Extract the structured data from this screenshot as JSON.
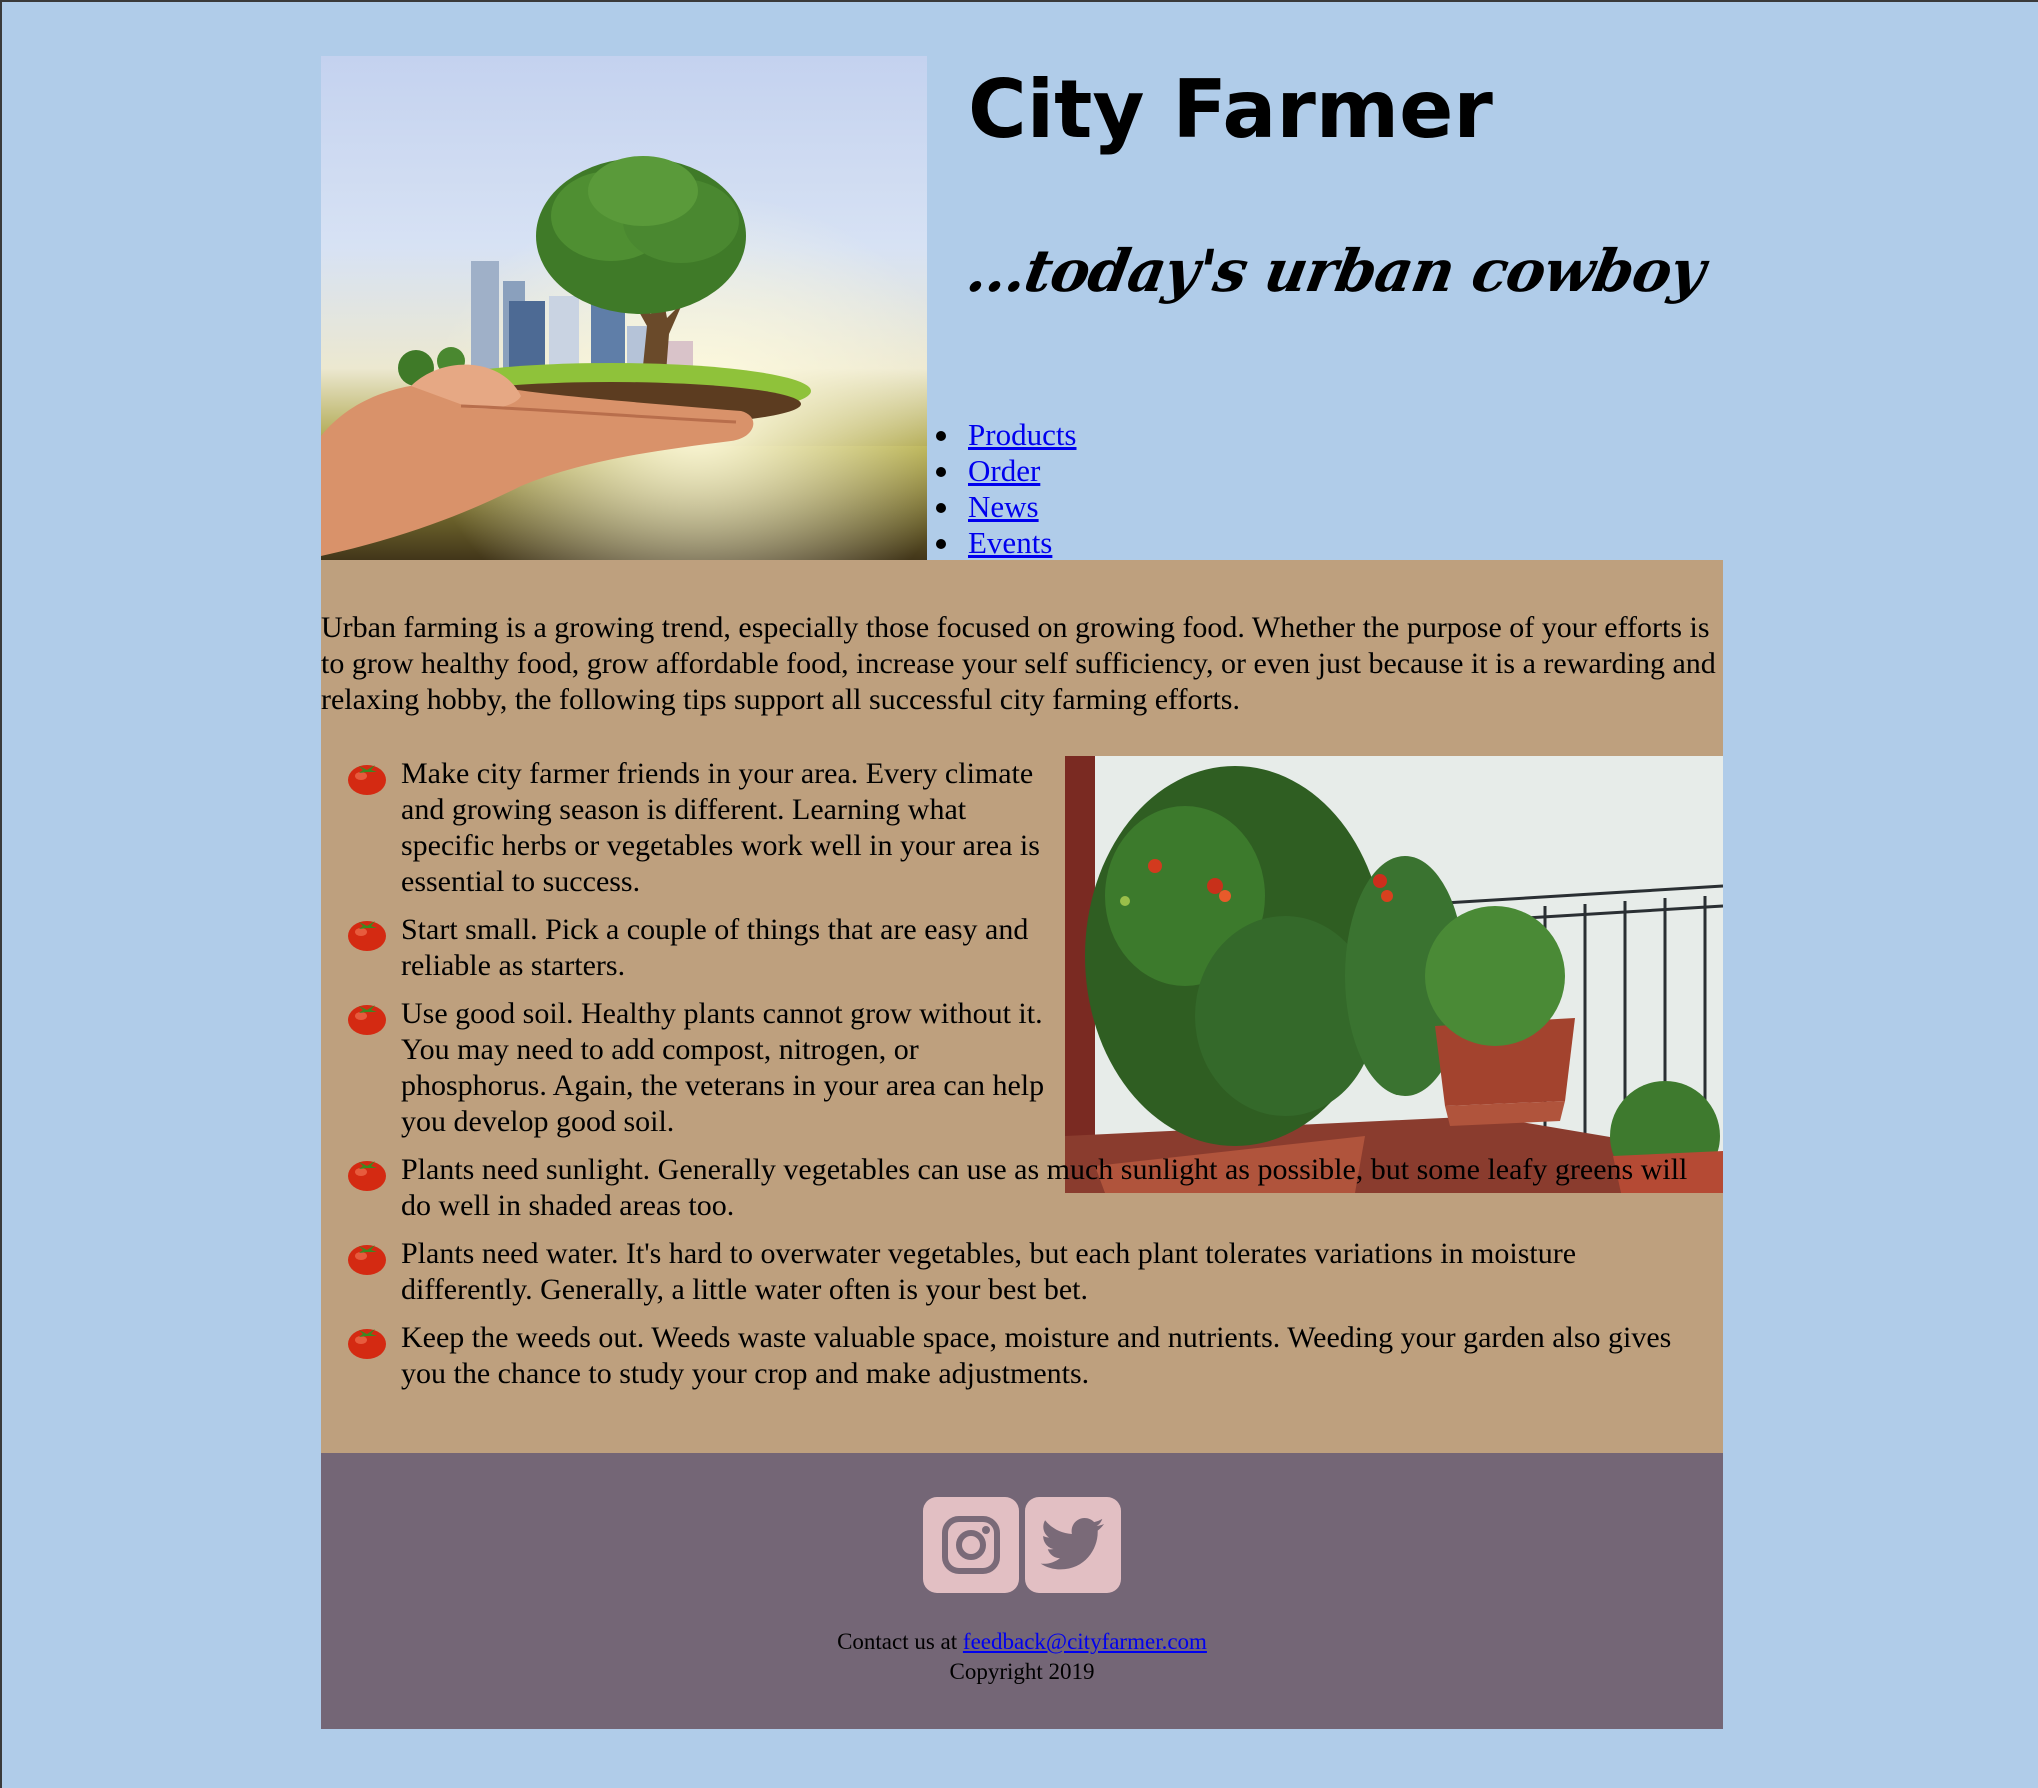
{
  "colors": {
    "page_background": "#b0cce9",
    "main_background": "#bea07e",
    "footer_background": "#746676",
    "social_button": "#e2bfc3",
    "link": "#0000ee"
  },
  "header": {
    "title": "City Farmer",
    "tagline": "...today's urban cowboy",
    "hero_image_alt": "hand holding a tree and city"
  },
  "nav": {
    "items": [
      {
        "label": "Products"
      },
      {
        "label": "Order"
      },
      {
        "label": "News"
      },
      {
        "label": "Events"
      }
    ]
  },
  "main": {
    "intro": "Urban farming is a growing trend, especially those focused on growing food. Whether the purpose of your efforts is to grow healthy food, grow affordable food, increase your self sufficiency, or even just because it is a rewarding and relaxing hobby, the following tips support all successful city farming efforts.",
    "tip_icon": "tomato-icon",
    "tips": [
      "Make city farmer friends in your area. Every climate and growing season is different. Learning what specific herbs or vegetables work well in your area is essential to success.",
      "Start small. Pick a couple of things that are easy and reliable as starters.",
      "Use good soil. Healthy plants cannot grow without it. You may need to add compost, nitrogen, or phosphorus. Again, the veterans in your area can help you develop good soil.",
      "Plants need sunlight. Generally vegetables can use as much sunlight as possible, but some leafy greens will do well in shaded areas too.",
      "Plants need water. It's hard to overwater vegetables, but each plant tolerates variations in moisture differently. Generally, a little water often is your best bet.",
      "Keep the weeds out. Weeds waste valuable space, moisture and nutrients. Weeding your garden also gives you the chance to study your crop and make adjustments."
    ]
  },
  "footer": {
    "social": [
      {
        "icon": "instagram-icon"
      },
      {
        "icon": "twitter-icon"
      }
    ],
    "contact_prefix": "Contact us at ",
    "contact_email": "feedback@cityfarmer.com",
    "copyright": "Copyright 2019"
  }
}
